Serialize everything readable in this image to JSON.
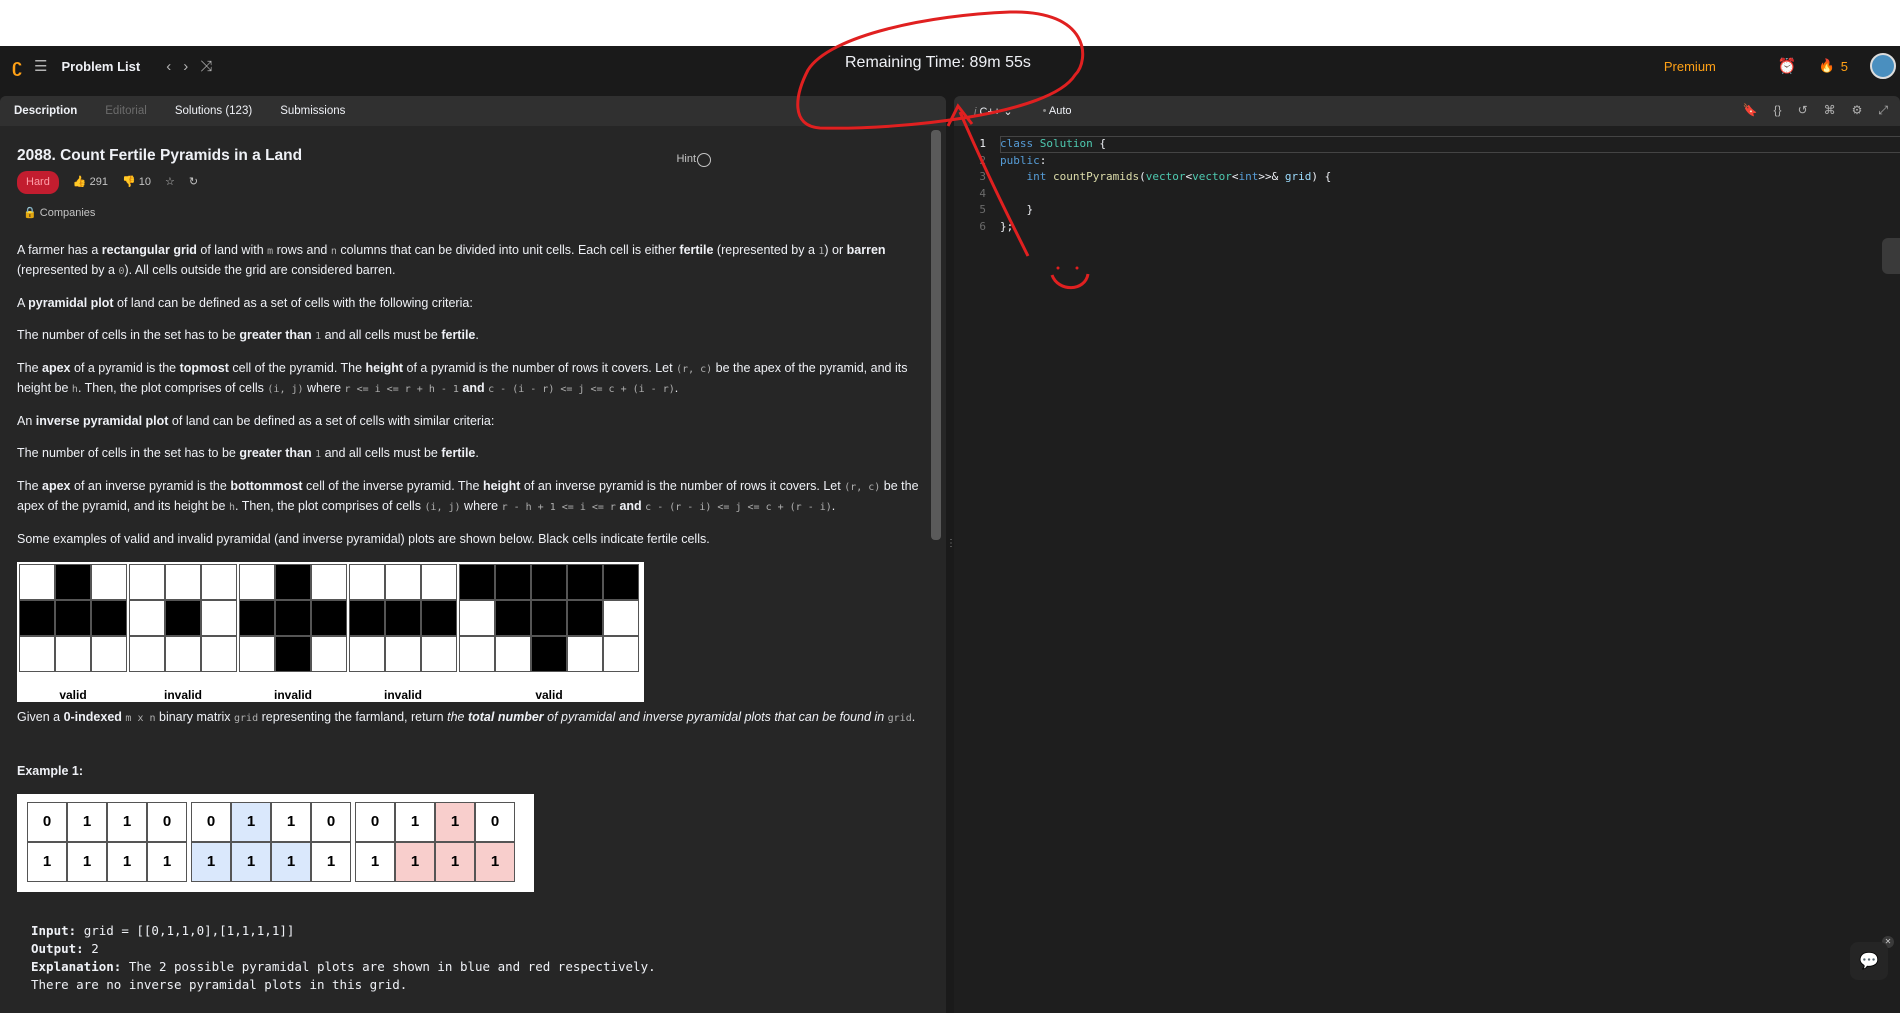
{
  "nav": {
    "problem_list": "Problem List",
    "timer": "Remaining Time: 89m 55s",
    "premium": "Premium",
    "streak": "5"
  },
  "tabs": [
    "Description",
    "Editorial",
    "Solutions (123)",
    "Submissions"
  ],
  "problem": {
    "title": "2088. Count Fertile Pyramids in a Land",
    "hint": "Hint",
    "difficulty": "Hard",
    "likes": "291",
    "dislikes": "10",
    "companies": "Companies"
  },
  "figure_labels": [
    "valid",
    "invalid",
    "invalid",
    "invalid",
    "valid"
  ],
  "example": {
    "heading": "Example 1:",
    "input_label": "Input:",
    "input_value": "grid = [[0,1,1,0],[1,1,1,1]]",
    "output_label": "Output:",
    "output_value": "2",
    "explanation_label": "Explanation:",
    "explanation_text": "The 2 possible pyramidal plots are shown in blue and red respectively.",
    "explanation_more": "There are no inverse pyramidal plots in this grid."
  },
  "editor": {
    "language": "C++",
    "mode": "Auto",
    "lines": [
      "1",
      "2",
      "3",
      "4",
      "5",
      "6"
    ]
  },
  "colors": {
    "accent": "#ffa116",
    "hard": "#c21d2f",
    "blue_cell": "#dae8fc",
    "red_cell": "#f8cecc"
  }
}
